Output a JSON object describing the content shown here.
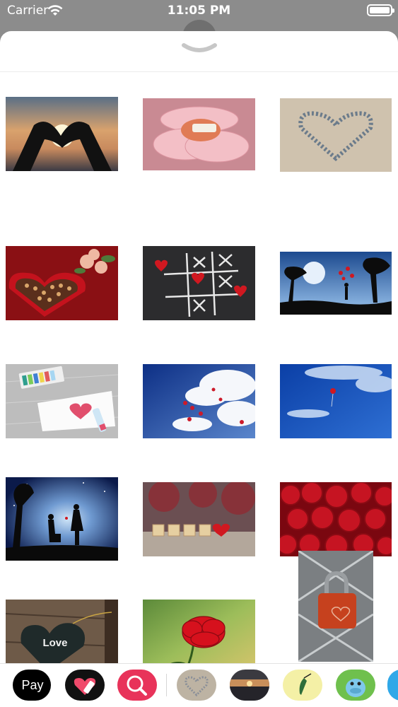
{
  "status_bar": {
    "carrier": "Carrier",
    "time": "11:05 PM"
  },
  "sheet": {
    "collapse_icon": "chevron-down-icon"
  },
  "grid": {
    "items": [
      {
        "name": "hands-heart-sunset"
      },
      {
        "name": "love-daisy"
      },
      {
        "name": "pebble-heart-sand"
      },
      {
        "name": "chocolate-box"
      },
      {
        "name": "tic-tac-toe-hearts"
      },
      {
        "name": "silhouette-balloons"
      },
      {
        "name": "crayon-heart-paper"
      },
      {
        "name": "heart-balloons-sky"
      },
      {
        "name": "single-balloon-sky"
      },
      {
        "name": "proposal-silhouette"
      },
      {
        "name": "scrabble-love"
      },
      {
        "name": "red-roses"
      },
      {
        "name": "love-heart-tag",
        "text": "Love"
      },
      {
        "name": "red-rose"
      },
      {
        "name": "heart-padlock"
      }
    ]
  },
  "tray": {
    "apple_pay_label": "Pay",
    "items": [
      "apple-pay",
      "heart-stickers-app",
      "image-search-app",
      "love-images-app",
      "sunset-app",
      "hummingbird-app",
      "hippo-app",
      "more-app"
    ]
  }
}
